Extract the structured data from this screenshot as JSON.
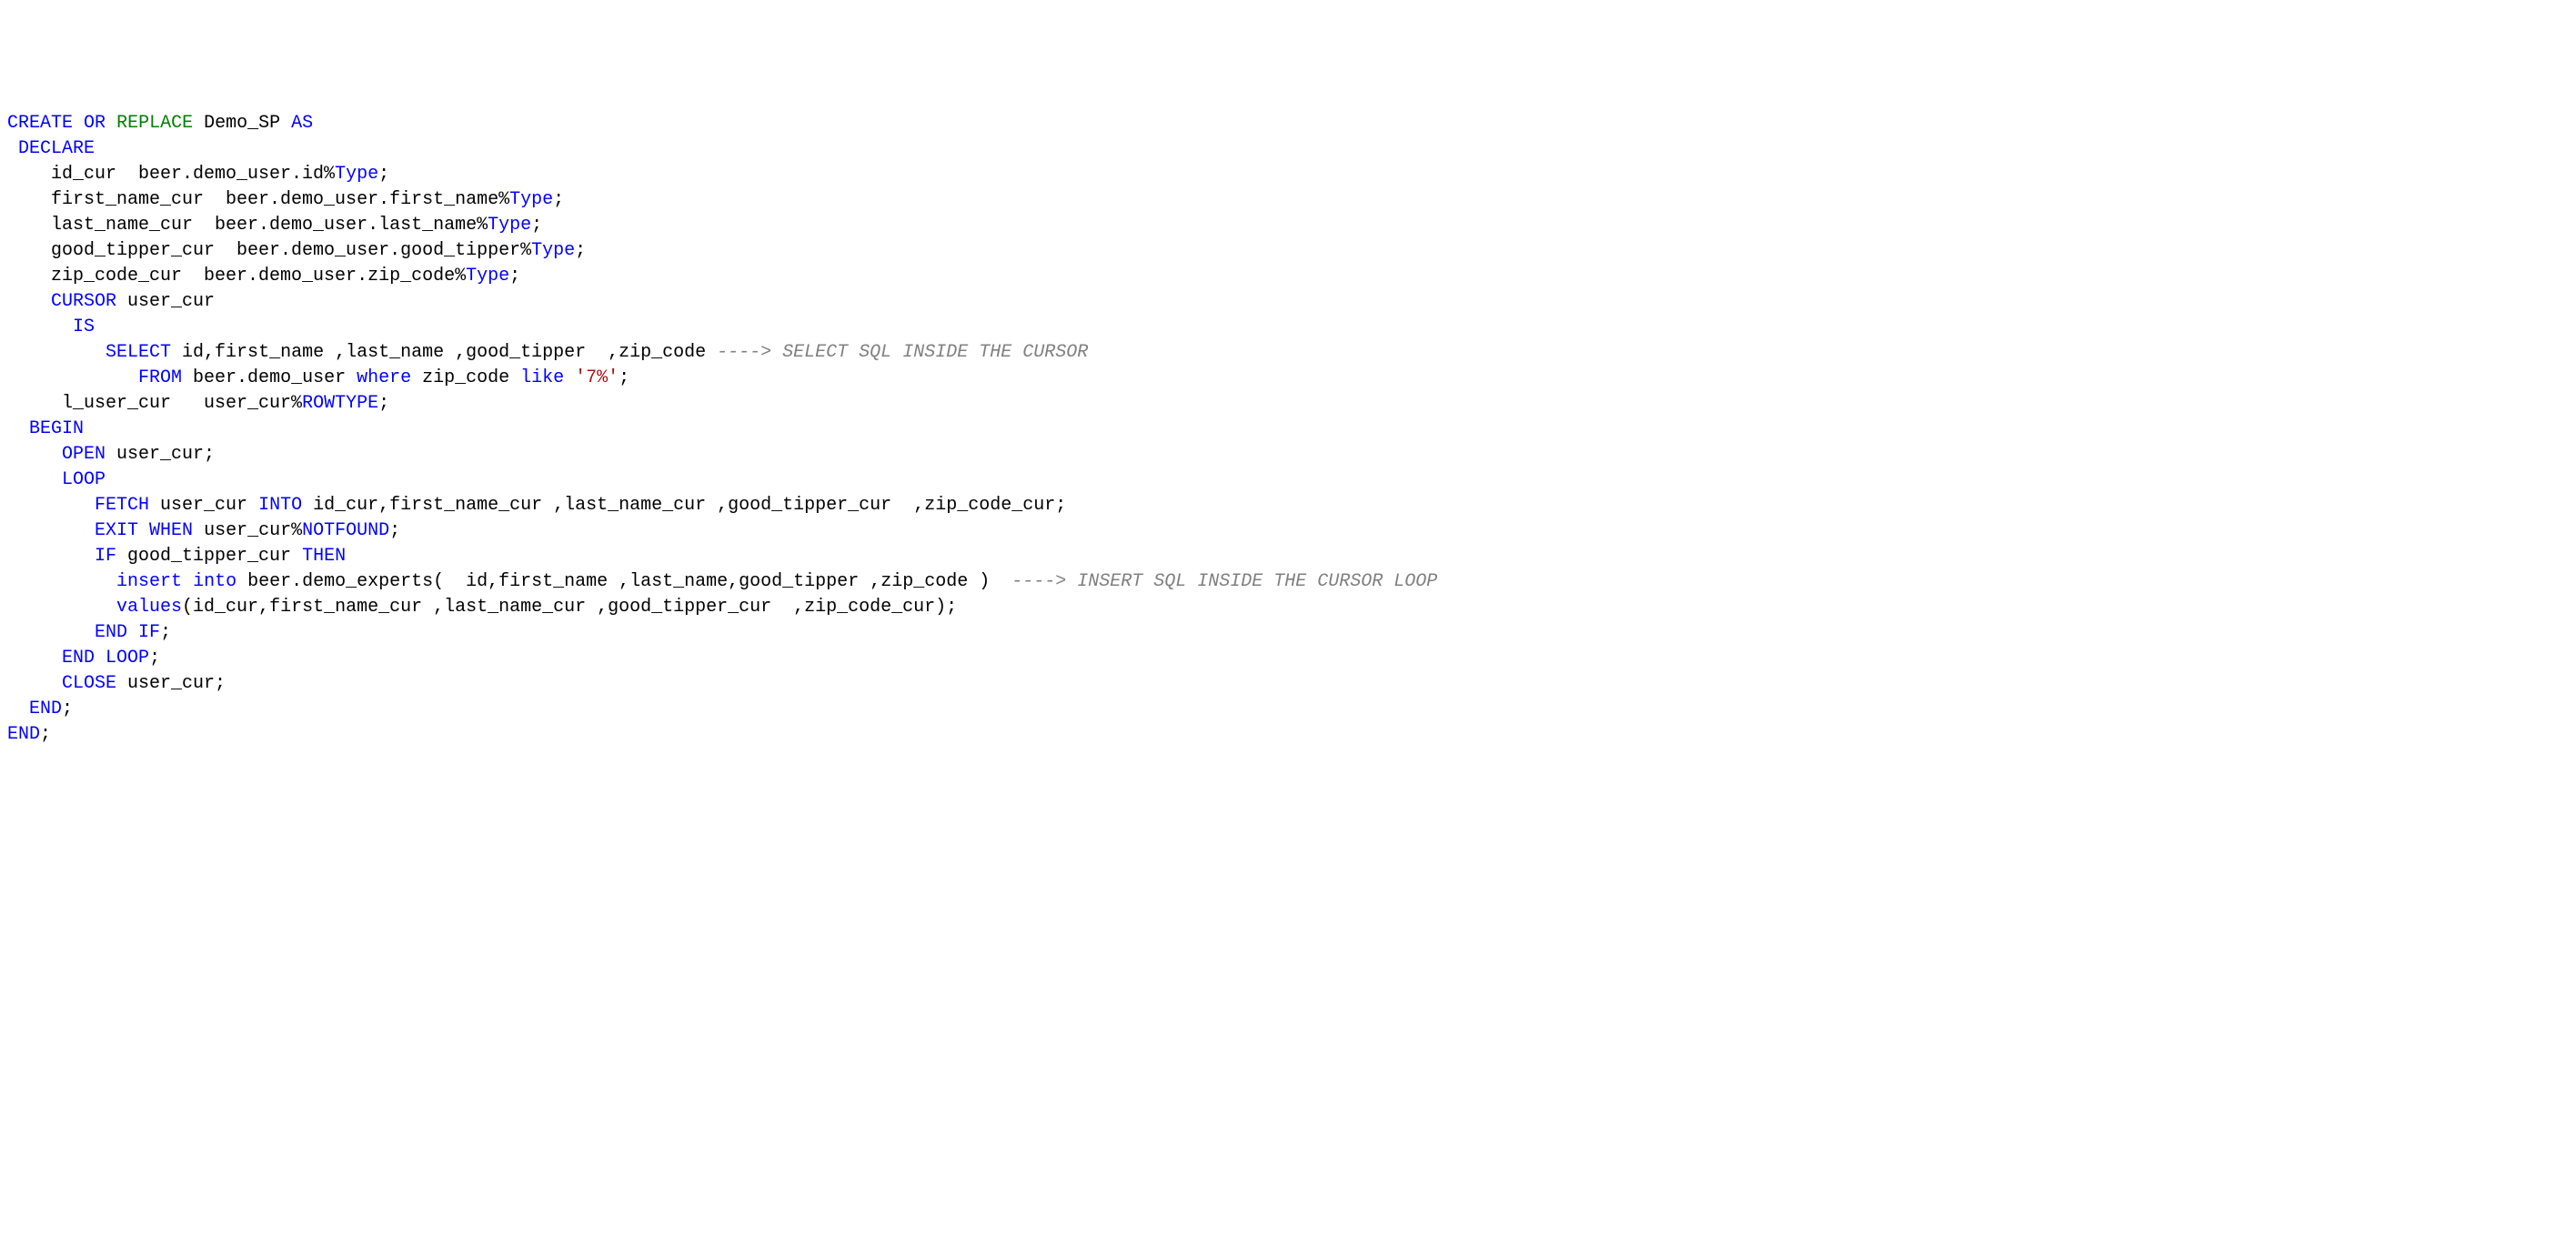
{
  "code": {
    "lines": [
      [
        {
          "t": "CREATE",
          "c": "kw-blue"
        },
        {
          "t": " ",
          "c": "default"
        },
        {
          "t": "OR",
          "c": "kw-blue"
        },
        {
          "t": " ",
          "c": "default"
        },
        {
          "t": "REPLACE",
          "c": "kw-green"
        },
        {
          "t": " Demo_SP ",
          "c": "default"
        },
        {
          "t": "AS",
          "c": "kw-blue"
        }
      ],
      [
        {
          "t": " ",
          "c": "default"
        },
        {
          "t": "DECLARE",
          "c": "kw-blue"
        }
      ],
      [
        {
          "t": "    id_cur  beer.demo_user.id%",
          "c": "default"
        },
        {
          "t": "Type",
          "c": "kw-blue"
        },
        {
          "t": ";",
          "c": "default"
        }
      ],
      [
        {
          "t": "    first_name_cur  beer.demo_user.first_name%",
          "c": "default"
        },
        {
          "t": "Type",
          "c": "kw-blue"
        },
        {
          "t": ";",
          "c": "default"
        }
      ],
      [
        {
          "t": "    last_name_cur  beer.demo_user.last_name%",
          "c": "default"
        },
        {
          "t": "Type",
          "c": "kw-blue"
        },
        {
          "t": ";",
          "c": "default"
        }
      ],
      [
        {
          "t": "    good_tipper_cur  beer.demo_user.good_tipper%",
          "c": "default"
        },
        {
          "t": "Type",
          "c": "kw-blue"
        },
        {
          "t": ";",
          "c": "default"
        }
      ],
      [
        {
          "t": "    zip_code_cur  beer.demo_user.zip_code%",
          "c": "default"
        },
        {
          "t": "Type",
          "c": "kw-blue"
        },
        {
          "t": ";",
          "c": "default"
        }
      ],
      [
        {
          "t": "",
          "c": "default"
        }
      ],
      [
        {
          "t": "",
          "c": "default"
        }
      ],
      [
        {
          "t": "    ",
          "c": "default"
        },
        {
          "t": "CURSOR",
          "c": "kw-blue"
        },
        {
          "t": " user_cur",
          "c": "default"
        }
      ],
      [
        {
          "t": "      ",
          "c": "default"
        },
        {
          "t": "IS",
          "c": "kw-blue"
        }
      ],
      [
        {
          "t": "         ",
          "c": "default"
        },
        {
          "t": "SELECT",
          "c": "kw-blue"
        },
        {
          "t": " id,first_name ,last_name ,good_tipper  ,zip_code ",
          "c": "default"
        },
        {
          "t": "----> SELECT SQL INSIDE THE CURSOR",
          "c": "comment"
        }
      ],
      [
        {
          "t": "            ",
          "c": "default"
        },
        {
          "t": "FROM",
          "c": "kw-blue"
        },
        {
          "t": " beer.demo_user ",
          "c": "default"
        },
        {
          "t": "where",
          "c": "kw-blue"
        },
        {
          "t": " zip_code ",
          "c": "default"
        },
        {
          "t": "like",
          "c": "kw-blue"
        },
        {
          "t": " ",
          "c": "default"
        },
        {
          "t": "'7%'",
          "c": "kw-red"
        },
        {
          "t": ";",
          "c": "default"
        }
      ],
      [
        {
          "t": "",
          "c": "default"
        }
      ],
      [
        {
          "t": "     l_user_cur   user_cur%",
          "c": "default"
        },
        {
          "t": "ROWTYPE",
          "c": "kw-blue"
        },
        {
          "t": ";",
          "c": "default"
        }
      ],
      [
        {
          "t": "  ",
          "c": "default"
        },
        {
          "t": "BEGIN",
          "c": "kw-blue"
        }
      ],
      [
        {
          "t": "     ",
          "c": "default"
        },
        {
          "t": "OPEN",
          "c": "kw-blue"
        },
        {
          "t": " user_cur;",
          "c": "default"
        }
      ],
      [
        {
          "t": "",
          "c": "default"
        }
      ],
      [
        {
          "t": "     ",
          "c": "default"
        },
        {
          "t": "LOOP",
          "c": "kw-blue"
        }
      ],
      [
        {
          "t": "        ",
          "c": "default"
        },
        {
          "t": "FETCH",
          "c": "kw-blue"
        },
        {
          "t": " user_cur ",
          "c": "default"
        },
        {
          "t": "INTO",
          "c": "kw-blue"
        },
        {
          "t": " id_cur,first_name_cur ,last_name_cur ,good_tipper_cur  ,zip_code_cur;",
          "c": "default"
        }
      ],
      [
        {
          "t": "        ",
          "c": "default"
        },
        {
          "t": "EXIT",
          "c": "kw-blue"
        },
        {
          "t": " ",
          "c": "default"
        },
        {
          "t": "WHEN",
          "c": "kw-blue"
        },
        {
          "t": " user_cur%",
          "c": "default"
        },
        {
          "t": "NOTFOUND",
          "c": "kw-blue"
        },
        {
          "t": ";",
          "c": "default"
        }
      ],
      [
        {
          "t": "",
          "c": "default"
        }
      ],
      [
        {
          "t": "        ",
          "c": "default"
        },
        {
          "t": "IF",
          "c": "kw-blue"
        },
        {
          "t": " good_tipper_cur ",
          "c": "default"
        },
        {
          "t": "THEN",
          "c": "kw-blue"
        }
      ],
      [
        {
          "t": "          ",
          "c": "default"
        },
        {
          "t": "insert",
          "c": "kw-blue"
        },
        {
          "t": " ",
          "c": "default"
        },
        {
          "t": "into",
          "c": "kw-blue"
        },
        {
          "t": " beer.demo_experts(  id,first_name ,last_name,good_tipper ,zip_code )  ",
          "c": "default"
        },
        {
          "t": "----> INSERT SQL INSIDE THE CURSOR LOOP",
          "c": "comment"
        }
      ],
      [
        {
          "t": "          ",
          "c": "default"
        },
        {
          "t": "values",
          "c": "kw-blue"
        },
        {
          "t": "(id_cur,first_name_cur ,last_name_cur ,good_tipper_cur  ,zip_code_cur);",
          "c": "default"
        }
      ],
      [
        {
          "t": "        ",
          "c": "default"
        },
        {
          "t": "END",
          "c": "kw-blue"
        },
        {
          "t": " ",
          "c": "default"
        },
        {
          "t": "IF",
          "c": "kw-blue"
        },
        {
          "t": ";",
          "c": "default"
        }
      ],
      [
        {
          "t": "",
          "c": "default"
        }
      ],
      [
        {
          "t": "     ",
          "c": "default"
        },
        {
          "t": "END",
          "c": "kw-blue"
        },
        {
          "t": " ",
          "c": "default"
        },
        {
          "t": "LOOP",
          "c": "kw-blue"
        },
        {
          "t": ";",
          "c": "default"
        }
      ],
      [
        {
          "t": "",
          "c": "default"
        }
      ],
      [
        {
          "t": "     ",
          "c": "default"
        },
        {
          "t": "CLOSE",
          "c": "kw-blue"
        },
        {
          "t": " user_cur;",
          "c": "default"
        }
      ],
      [
        {
          "t": "  ",
          "c": "default"
        },
        {
          "t": "END",
          "c": "kw-blue"
        },
        {
          "t": ";",
          "c": "default"
        }
      ],
      [
        {
          "t": "END",
          "c": "kw-blue"
        },
        {
          "t": ";",
          "c": "default"
        }
      ]
    ]
  }
}
